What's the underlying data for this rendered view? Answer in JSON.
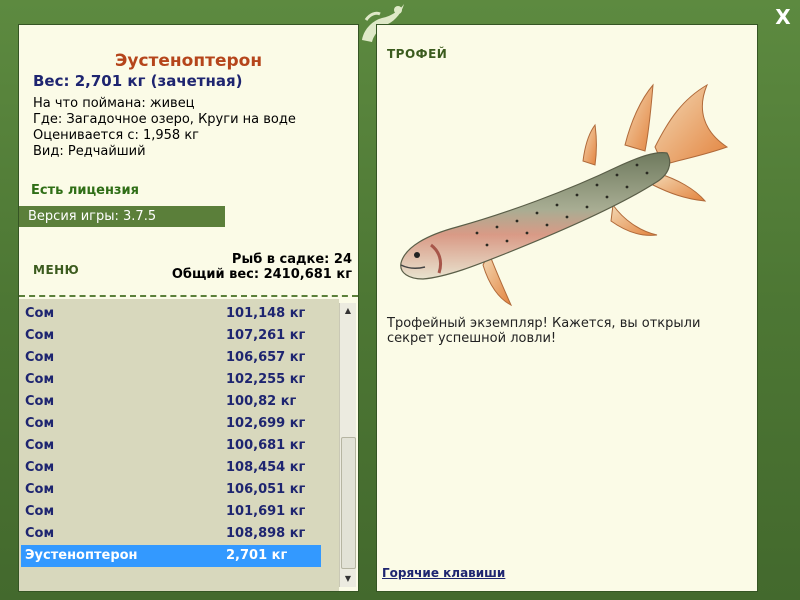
{
  "close_label": "X",
  "fish": {
    "name": "Эустеноптерон",
    "weight_line": "Вес: 2,701 кг (зачетная)",
    "caught_on": "На что поймана: живец",
    "location": "Где: Загадочное озеро, Круги на воде",
    "valued_from": "Оценивается с: 1,958 кг",
    "kind": "Вид: Редчайший"
  },
  "license": "Есть лицензия",
  "version": "Версия игры: 3.7.5",
  "menu_label": "МЕНЮ",
  "stats": {
    "fish_in_keepnet": "Рыб в садке: 24",
    "total_weight": "Общий вес: 2410,681 кг"
  },
  "catch_list": [
    {
      "name": "Сом",
      "weight": "101,148 кг"
    },
    {
      "name": "Сом",
      "weight": "107,261 кг"
    },
    {
      "name": "Сом",
      "weight": "106,657 кг"
    },
    {
      "name": "Сом",
      "weight": "102,255 кг"
    },
    {
      "name": "Сом",
      "weight": "100,82 кг"
    },
    {
      "name": "Сом",
      "weight": "102,699 кг"
    },
    {
      "name": "Сом",
      "weight": "100,681 кг"
    },
    {
      "name": "Сом",
      "weight": "108,454 кг"
    },
    {
      "name": "Сом",
      "weight": "106,051 кг"
    },
    {
      "name": "Сом",
      "weight": "101,691 кг"
    },
    {
      "name": "Сом",
      "weight": "108,898 кг"
    },
    {
      "name": "Эустеноптерон",
      "weight": "2,701 кг",
      "selected": true
    }
  ],
  "trophy": {
    "title": "ТРОФЕЙ",
    "message": "Трофейный экземпляр! Кажется, вы открыли секрет успешной ловли!",
    "hotkeys_link": "Горячие клавиши"
  },
  "colors": {
    "frame": "#4f7a36",
    "panel": "#fbfbe7",
    "selection": "#3399ff",
    "fish_name": "#b5451b",
    "list_text": "#1e2570"
  },
  "icons": {
    "logo": "lizard-logo-icon",
    "close": "close-icon",
    "scroll_up": "scroll-up-arrow-icon",
    "scroll_down": "scroll-down-arrow-icon"
  }
}
